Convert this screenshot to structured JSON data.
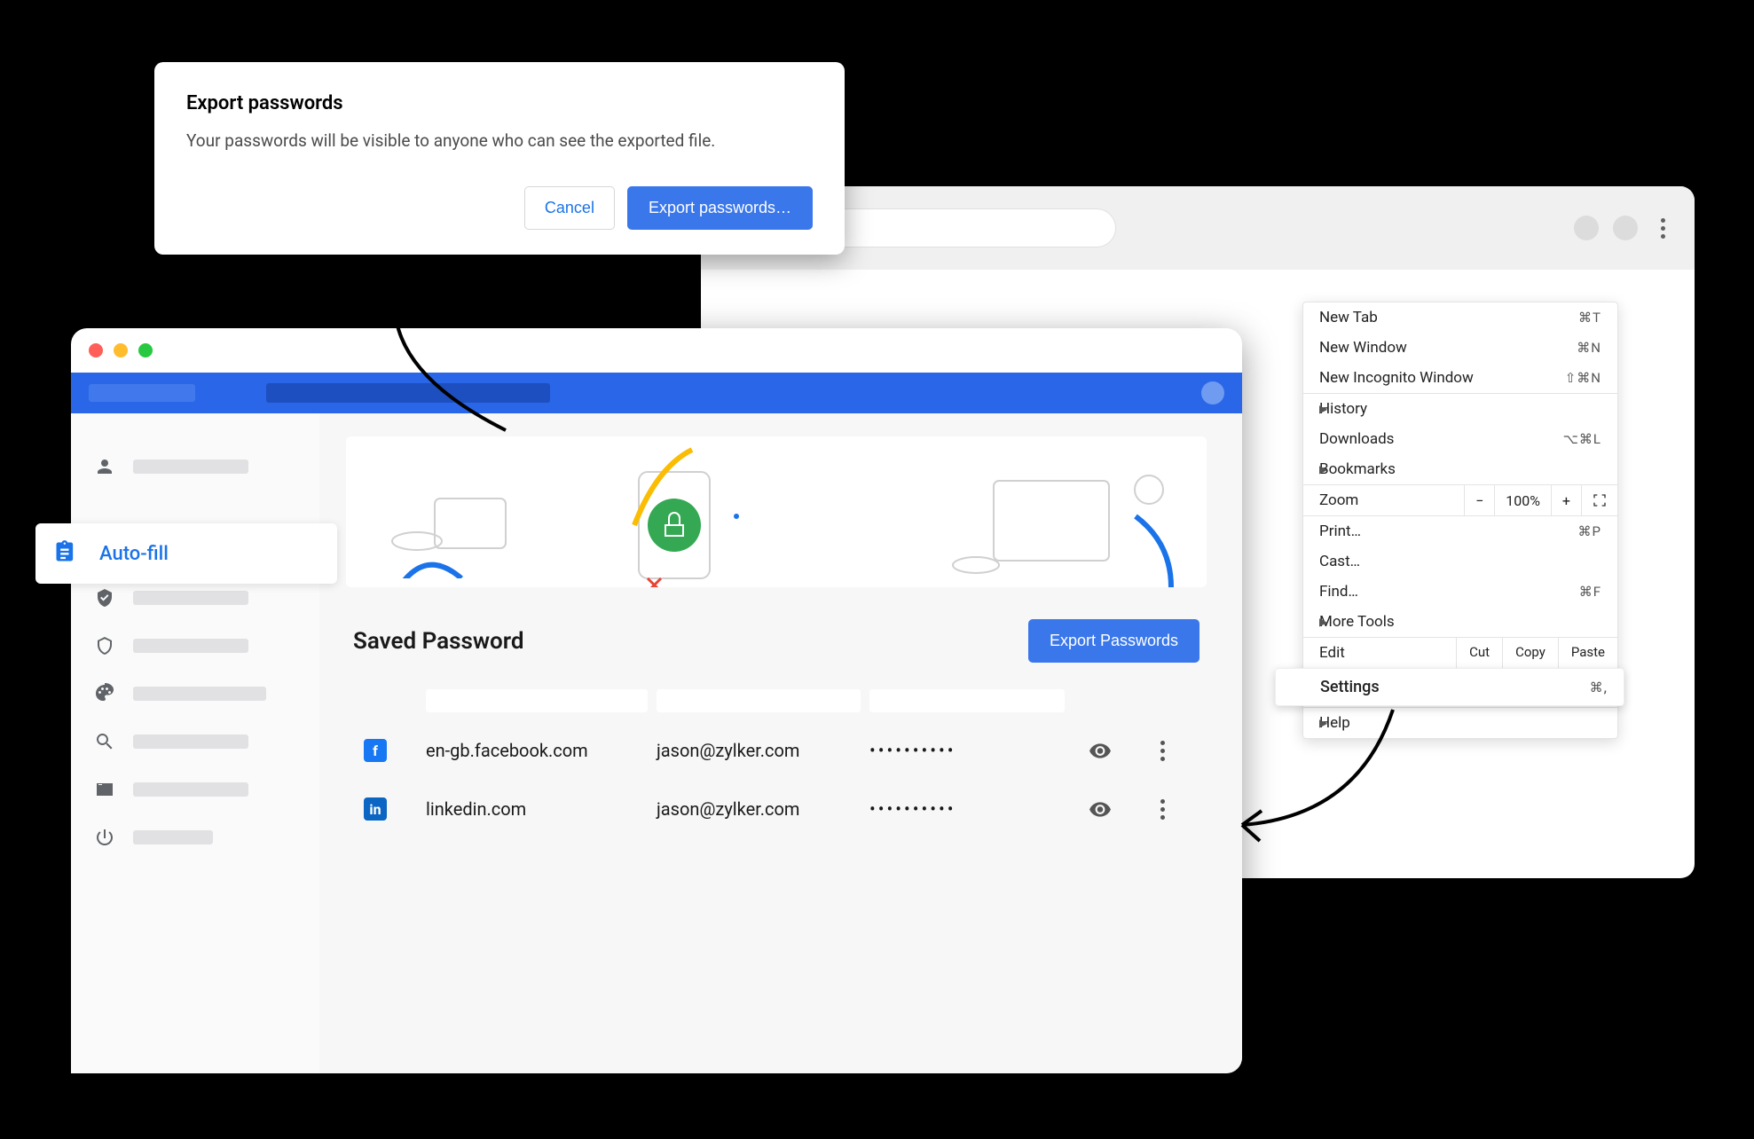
{
  "dialog": {
    "title": "Export passwords",
    "body": "Your passwords will be visible to anyone who can see the exported file.",
    "cancel": "Cancel",
    "confirm": "Export passwords…"
  },
  "chrome_menu": {
    "new_tab": "New Tab",
    "new_tab_sc": "⌘T",
    "new_window": "New Window",
    "new_window_sc": "⌘N",
    "incognito": "New Incognito Window",
    "incognito_sc": "⇧⌘N",
    "history": "History",
    "downloads": "Downloads",
    "downloads_sc": "⌥⌘L",
    "bookmarks": "Bookmarks",
    "zoom": "Zoom",
    "zoom_out": "−",
    "zoom_value": "100%",
    "zoom_in": "+",
    "print": "Print…",
    "print_sc": "⌘P",
    "cast": "Cast…",
    "find": "Find…",
    "find_sc": "⌘F",
    "more_tools": "More Tools",
    "edit": "Edit",
    "cut": "Cut",
    "copy": "Copy",
    "paste": "Paste",
    "settings": "Settings",
    "settings_sc": "⌘,",
    "help": "Help"
  },
  "settings": {
    "autofill_label": "Auto-fill",
    "saved_title": "Saved Password",
    "export_btn": "Export Passwords",
    "rows": [
      {
        "site": "en-gb.facebook.com",
        "user": "jason@zylker.com",
        "pw": "••••••••••"
      },
      {
        "site": "linkedin.com",
        "user": "jason@zylker.com",
        "pw": "••••••••••"
      }
    ]
  }
}
